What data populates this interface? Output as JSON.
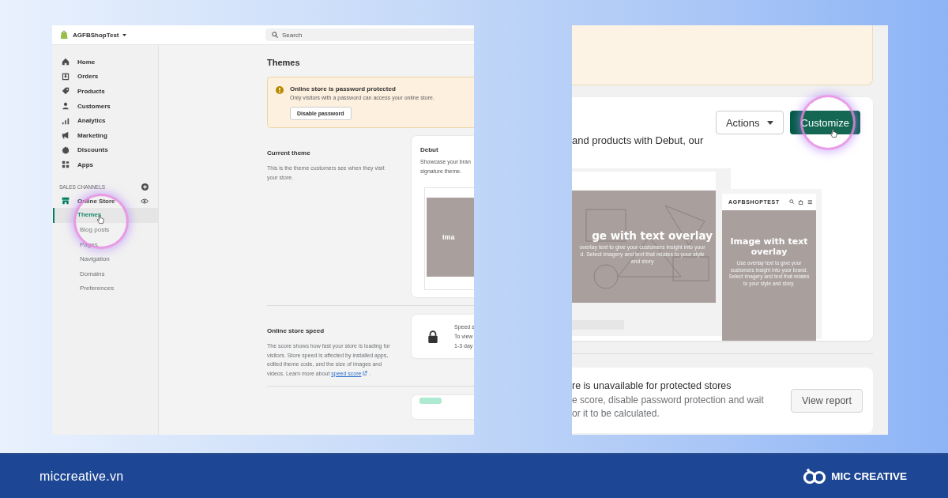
{
  "left_screenshot": {
    "store_name": "AGFBShopTest",
    "search": {
      "placeholder": "Search"
    },
    "nav": [
      {
        "label": "Home"
      },
      {
        "label": "Orders"
      },
      {
        "label": "Products"
      },
      {
        "label": "Customers"
      },
      {
        "label": "Analytics"
      },
      {
        "label": "Marketing"
      },
      {
        "label": "Discounts"
      },
      {
        "label": "Apps"
      }
    ],
    "sales_channels": {
      "heading": "SALES CHANNELS",
      "channel": "Online Store",
      "subitems": [
        {
          "label": "Themes",
          "selected": true
        },
        {
          "label": "Blog posts",
          "selected": false
        },
        {
          "label": "Pages",
          "selected": false
        },
        {
          "label": "Navigation",
          "selected": false
        },
        {
          "label": "Domains",
          "selected": false
        },
        {
          "label": "Preferences",
          "selected": false
        }
      ]
    },
    "page_title": "Themes",
    "banner": {
      "title": "Online store is password protected",
      "text": "Only visitors with a password can access your online store.",
      "button": "Disable password"
    },
    "current_theme": {
      "title": "Current theme",
      "description": "This is the theme customers see when they visit your store.",
      "card_title": "Debut",
      "card_lines": [
        "Showcase your bran",
        "signature theme."
      ],
      "preview_heading": "Ima"
    },
    "store_speed": {
      "title": "Online store speed",
      "description": "The score shows how fast your store is loading for visitors. Store speed is affected by installed apps, edited theme code, and the size of images and videos. Learn more about",
      "link": "speed score",
      "suffix": " .",
      "card_lines": [
        "Speed s",
        "To view",
        "1-3 day"
      ]
    }
  },
  "right_screenshot": {
    "actions_button": "Actions",
    "customize_button": "Customize",
    "description": "and products with Debut, our",
    "desktop_preview": {
      "heading": "ge with text overlay",
      "text_lines": [
        "overlay text to give your customers insight into your",
        "d. Select imagery and text that relates to your style",
        "and story"
      ]
    },
    "mobile_preview": {
      "store_name": "AGFBSHOPTEST",
      "heading": "Image with text overlay",
      "text": "Use overlay text to give your customers insight into your brand. Select imagery and text that relates to your style and story."
    },
    "speed_card": {
      "title": "re is unavailable for protected stores",
      "text_lines": [
        "e score, disable password protection and wait",
        "or it to be calculated."
      ],
      "button": "View report"
    }
  },
  "footer": {
    "site": "miccreative.vn",
    "brand": "MIC CREATIVE"
  }
}
